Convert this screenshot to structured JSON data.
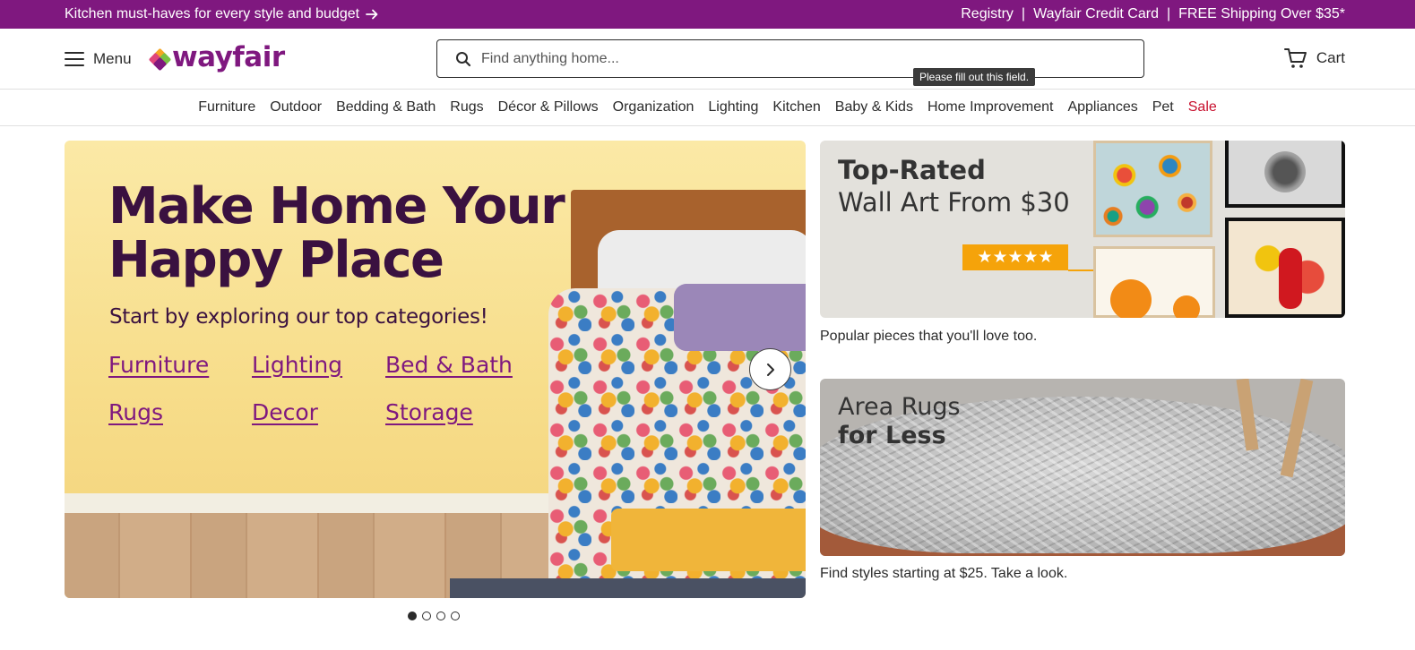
{
  "promo": {
    "left_text": "Kitchen must-haves for every style and budget",
    "right_links": [
      "Registry",
      "Wayfair Credit Card",
      "FREE Shipping Over $35*"
    ],
    "separator": "|",
    "bg_color": "#7f187f"
  },
  "header": {
    "menu_label": "Menu",
    "logo_text": "wayfair",
    "search_placeholder": "Find anything home...",
    "tooltip": "Please fill out this field.",
    "cart_label": "Cart"
  },
  "categories": [
    {
      "label": "Furniture"
    },
    {
      "label": "Outdoor"
    },
    {
      "label": "Bedding & Bath"
    },
    {
      "label": "Rugs"
    },
    {
      "label": "Décor & Pillows"
    },
    {
      "label": "Organization"
    },
    {
      "label": "Lighting"
    },
    {
      "label": "Kitchen"
    },
    {
      "label": "Baby & Kids"
    },
    {
      "label": "Home Improvement"
    },
    {
      "label": "Appliances"
    },
    {
      "label": "Pet"
    },
    {
      "label": "Sale",
      "color": "#c8102e"
    }
  ],
  "hero": {
    "headline": "Make Home Your Happy Place",
    "subheadline": "Start by exploring our top categories!",
    "links": [
      "Furniture",
      "Lighting",
      "Bed & Bath",
      "Rugs",
      "Decor",
      "Storage"
    ],
    "slide_count": 4,
    "active_slide": 1
  },
  "tiles": [
    {
      "title_bold": "Top-Rated",
      "title_regular": "Wall Art From $30",
      "rating_stars": "★★★★★",
      "caption": "Popular pieces that you'll love too."
    },
    {
      "title_regular": "Area Rugs",
      "title_bold": "for Less",
      "caption": "Find styles starting at $25. Take a look."
    }
  ],
  "icons": {
    "arrow": "arrow-right-icon",
    "menu": "hamburger-icon",
    "search": "search-icon",
    "cart": "cart-icon",
    "next": "chevron-right-icon"
  }
}
